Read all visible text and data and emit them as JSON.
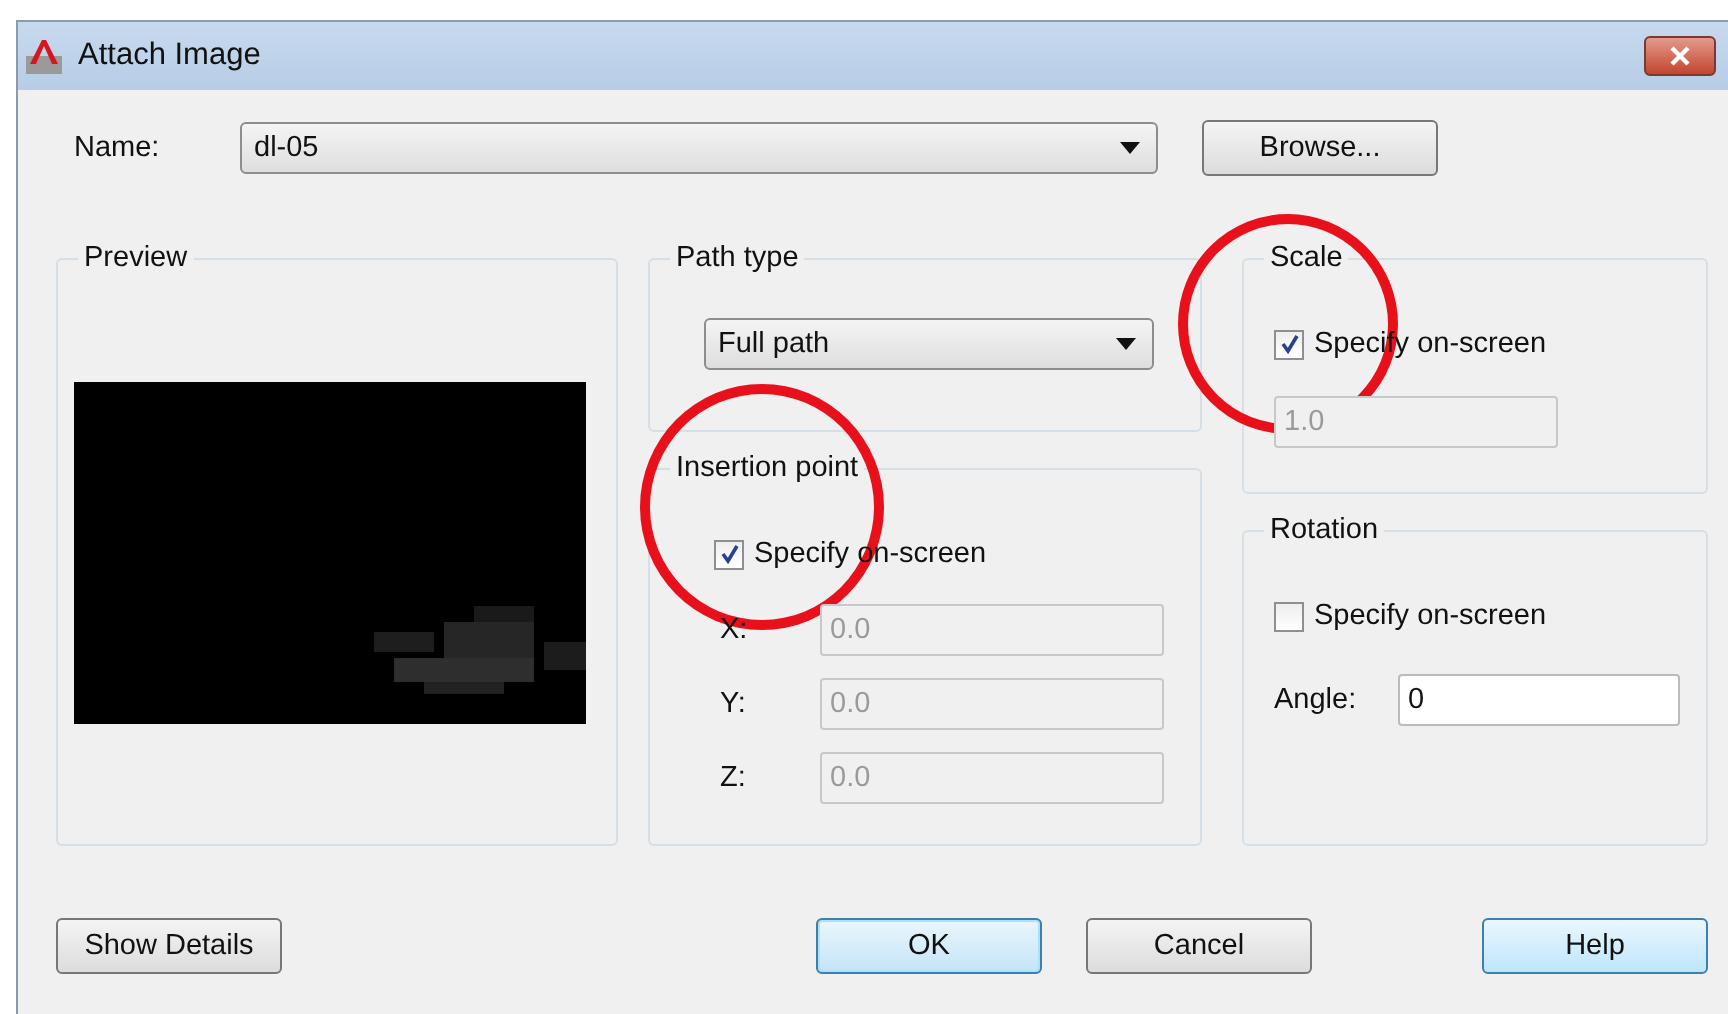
{
  "window": {
    "title": "Attach Image"
  },
  "name": {
    "label": "Name:",
    "value": "dl-05"
  },
  "browse_button": "Browse...",
  "preview": {
    "title": "Preview"
  },
  "path_type": {
    "title": "Path type",
    "value": "Full path"
  },
  "insertion_point": {
    "title": "Insertion point",
    "circled": true,
    "specify": {
      "label": "Specify on-screen",
      "checked": true
    },
    "fields": [
      {
        "label": "X:",
        "value": "0.0",
        "disabled": true
      },
      {
        "label": "Y:",
        "value": "0.0",
        "disabled": true
      },
      {
        "label": "Z:",
        "value": "0.0",
        "disabled": true
      }
    ]
  },
  "scale": {
    "title": "Scale",
    "circled": true,
    "specify": {
      "label": "Specify on-screen",
      "checked": true
    },
    "field": {
      "value": "1.0",
      "disabled": true
    }
  },
  "rotation": {
    "title": "Rotation",
    "specify": {
      "label": "Specify on-screen",
      "checked": false
    },
    "angle": {
      "label": "Angle:",
      "value": "0",
      "disabled": false
    }
  },
  "buttons": [
    {
      "label": "Show Details",
      "kind": "plain"
    },
    {
      "label": "OK",
      "kind": "default"
    },
    {
      "label": "Cancel",
      "kind": "plain"
    },
    {
      "label": "Help",
      "kind": "hover"
    }
  ]
}
